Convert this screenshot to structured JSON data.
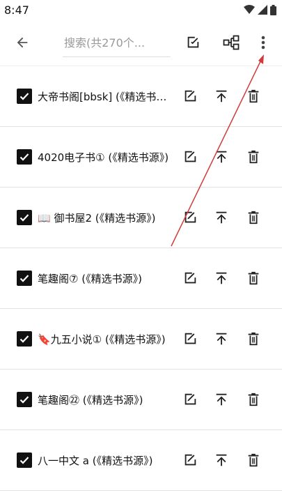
{
  "status": {
    "time": "8:47"
  },
  "search": {
    "placeholder": "搜索(共270个..."
  },
  "rows": [
    {
      "name": "大帝书阁[bbsk] (《精选书源》)"
    },
    {
      "name": "4020电子书① (《精选书源》)"
    },
    {
      "name": "📖 御书屋2 (《精选书源》)"
    },
    {
      "name": "笔趣阁⑦ (《精选书源》)"
    },
    {
      "name": "🔖九五小说① (《精选书源》)"
    },
    {
      "name": "笔趣阁㉒ (《精选书源》)"
    },
    {
      "name": "八一中文 a (《精选书源》)"
    }
  ],
  "colors": {
    "annotation": "#d23a3a",
    "text": "#111111",
    "divider": "#e2e2e2"
  },
  "icons": [
    "back-arrow-icon",
    "edit-icon",
    "group-icon",
    "more-vert-icon",
    "checkbox-checked-icon",
    "move-top-icon",
    "delete-icon",
    "wifi-icon",
    "signal-icon",
    "battery-icon"
  ]
}
